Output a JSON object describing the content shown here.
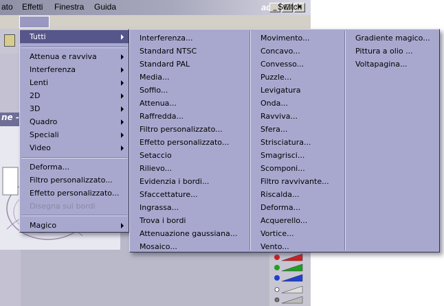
{
  "window": {
    "title": "act SE"
  },
  "menubar": {
    "items": [
      {
        "label": "ato"
      },
      {
        "label": "Effetti"
      },
      {
        "label": "Finestra"
      },
      {
        "label": "Guida"
      }
    ],
    "right_label": "Switch"
  },
  "document": {
    "title": "ne -"
  },
  "effetti_menu": {
    "items": [
      {
        "label": "Tutti",
        "submenu": true,
        "selected": true
      },
      {
        "label": "Attenua e ravviva",
        "submenu": true
      },
      {
        "label": "Interferenza",
        "submenu": true
      },
      {
        "label": "Lenti",
        "submenu": true
      },
      {
        "label": "2D",
        "submenu": true
      },
      {
        "label": "3D",
        "submenu": true
      },
      {
        "label": "Quadro",
        "submenu": true
      },
      {
        "label": "Speciali",
        "submenu": true
      },
      {
        "label": "Video",
        "submenu": true
      },
      {
        "label": "Deforma..."
      },
      {
        "label": "Filtro personalizzato..."
      },
      {
        "label": "Effetto personalizzato..."
      },
      {
        "label": "Disegna sui bordi",
        "disabled": true
      },
      {
        "label": "Magico",
        "submenu": true
      }
    ]
  },
  "tutti_menu": {
    "columns": [
      [
        "Interferenza...",
        "Standard NTSC",
        "Standard PAL",
        "Media...",
        "Soffio...",
        "Attenua...",
        "Raffredda...",
        "Filtro personalizzato...",
        "Effetto personalizzato...",
        "Setaccio",
        "Rilievo...",
        "Evidenzia i bordi...",
        "Sfaccettature...",
        "Ingrassa...",
        "Trova i bordi",
        "Attenuazione gaussiana...",
        "Mosaico..."
      ],
      [
        "Movimento...",
        "Concavo...",
        "Convesso...",
        "Puzzle...",
        "Levigatura",
        "Onda...",
        "Ravviva...",
        "Sfera...",
        "Strisciatura...",
        "Smagrisci...",
        "Scomponi...",
        "Filtro ravvivante...",
        "Riscalda...",
        "Deforma...",
        "Acquerello...",
        "Vortice...",
        "Vento..."
      ],
      [
        "Gradiente magico...",
        "Pittura a olio ...",
        "Voltapagina..."
      ]
    ]
  },
  "colors": {
    "menu_bg": "#a8a8cf",
    "highlight": "#56568a",
    "disabled_text": "#8888a8"
  }
}
